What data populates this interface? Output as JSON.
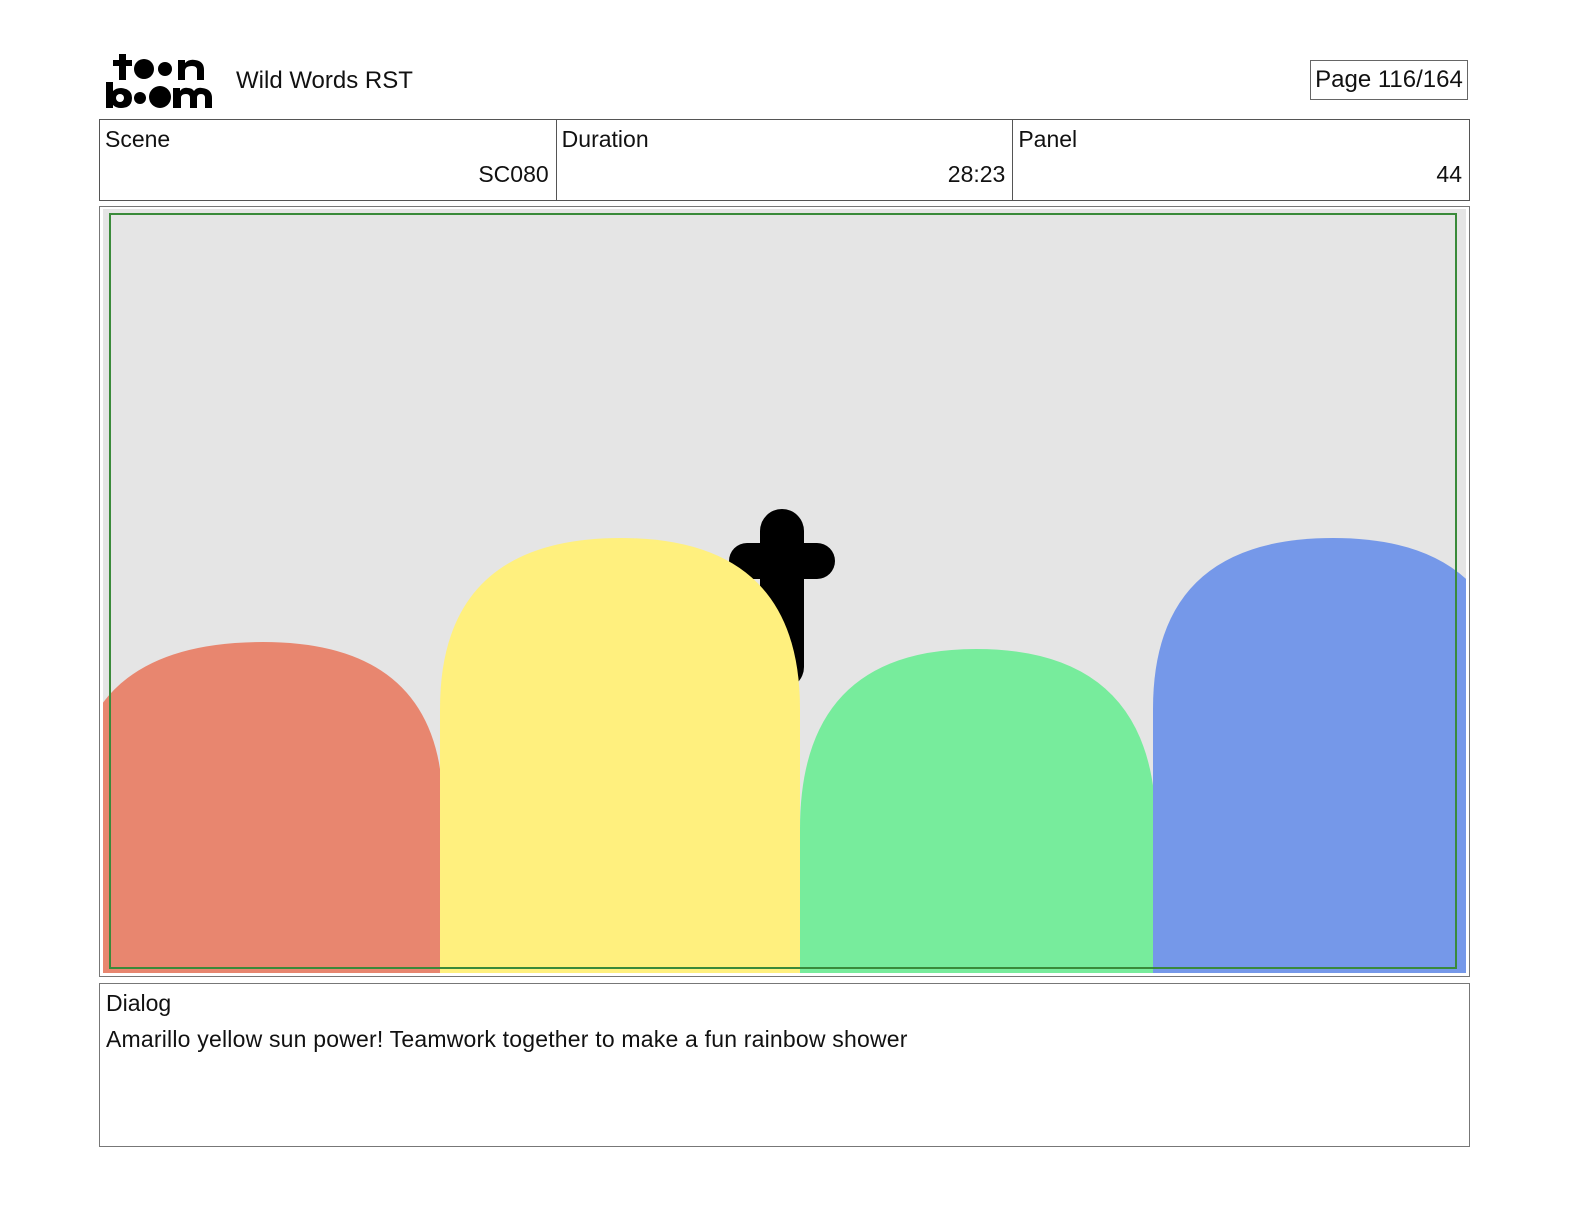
{
  "header": {
    "logo_text_top": "toon",
    "logo_text_bottom": "boom",
    "project_title": "Wild Words RST",
    "page_indicator": "Page 116/164"
  },
  "info": {
    "scene_label": "Scene",
    "scene_value": "SC080",
    "duration_label": "Duration",
    "duration_value": "28:23",
    "panel_label": "Panel",
    "panel_value": "44"
  },
  "panel": {
    "background_color": "#e5e5e5",
    "safe_frame_color": "#3a8a3a",
    "shapes": [
      {
        "name": "red-hill",
        "color": "#e8866f"
      },
      {
        "name": "yellow-hill",
        "color": "#fff07e"
      },
      {
        "name": "green-hill",
        "color": "#77ec9c"
      },
      {
        "name": "blue-hill",
        "color": "#7598e9"
      },
      {
        "name": "black-cross",
        "color": "#000000"
      }
    ]
  },
  "dialog": {
    "label": "Dialog",
    "text": "Amarillo yellow sun power! Teamwork together to make a fun rainbow shower"
  }
}
